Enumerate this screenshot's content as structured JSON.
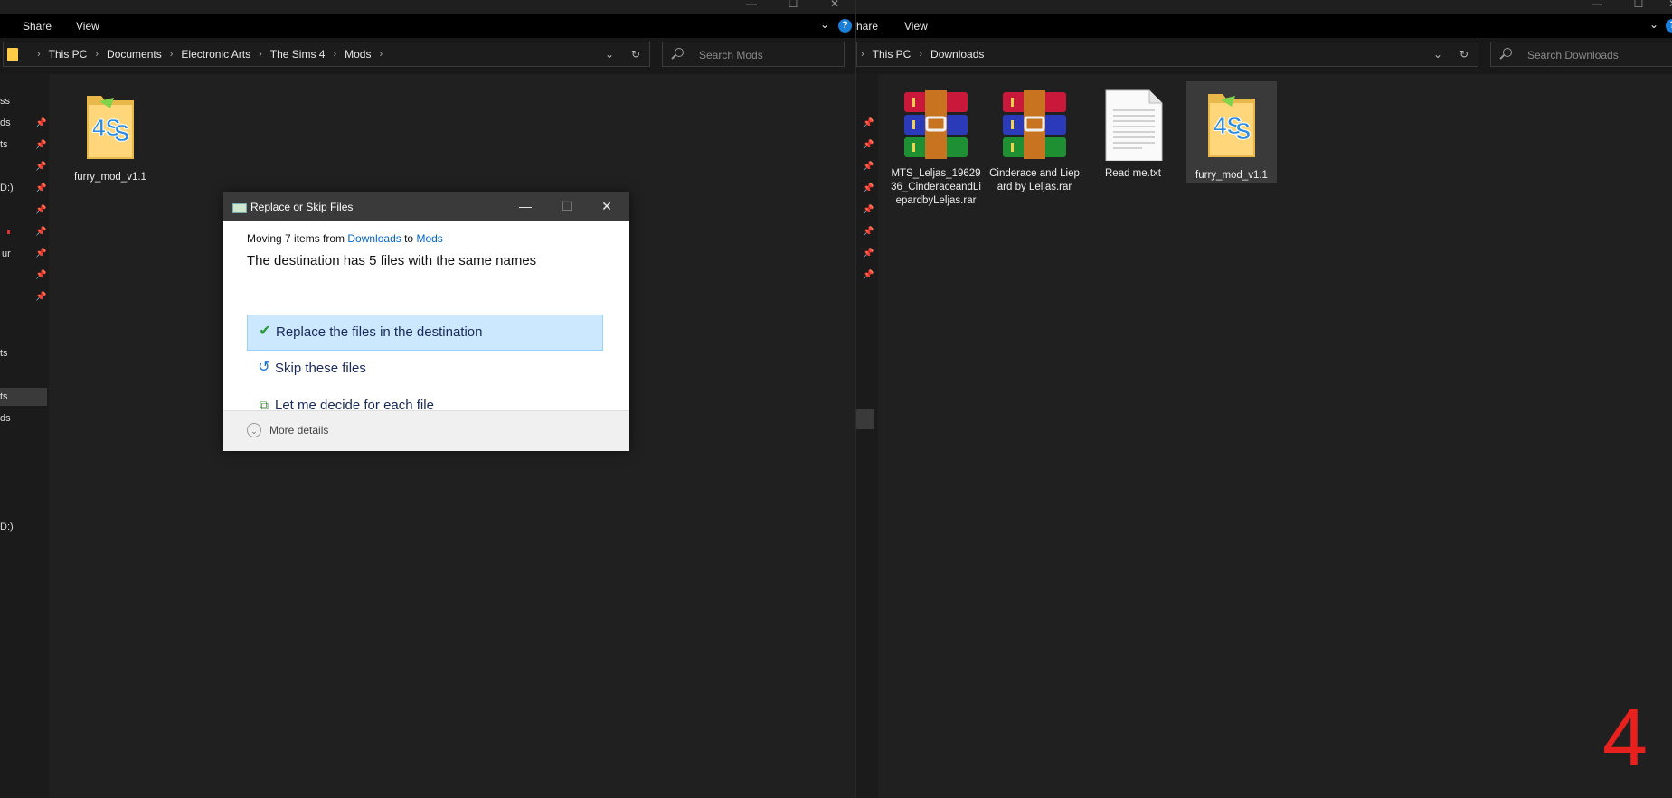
{
  "left_window": {
    "ribbon": {
      "tabs": [
        "Share",
        "View"
      ]
    },
    "address": {
      "crumbs": [
        "This PC",
        "Documents",
        "Electronic Arts",
        "The Sims 4",
        "Mods"
      ]
    },
    "search": {
      "placeholder": "Search Mods"
    },
    "nav_partial": [
      "ss",
      "ds",
      "ts",
      "D:)",
      "ur",
      "ts",
      "ts",
      "ds",
      "D:)"
    ],
    "items": [
      {
        "name": "furry_mod_v1.1"
      }
    ]
  },
  "right_window": {
    "ribbon": {
      "tabs": [
        "hare",
        "View"
      ]
    },
    "address": {
      "crumbs": [
        "This PC",
        "Downloads"
      ]
    },
    "search": {
      "placeholder": "Search Downloads"
    },
    "items": [
      {
        "name": "MTS_Leljas_1962936_CinderaceandLiepardbyLeljas.rar",
        "icon": "winrar-archive-icon"
      },
      {
        "name": "Cinderace and Liepard by Leljas.rar",
        "icon": "winrar-archive-icon"
      },
      {
        "name": "Read me.txt",
        "icon": "text-file-icon"
      },
      {
        "name": "furry_mod_v1.1",
        "icon": "sims-folder-icon"
      }
    ]
  },
  "dialog": {
    "title": "Replace or Skip Files",
    "moving_prefix": "Moving 7 items from",
    "source": "Downloads",
    "to_word": "to",
    "destination": "Mods",
    "headline": "The destination has 5 files with the same names",
    "options": {
      "replace": "Replace the files in the destination",
      "skip": "Skip these files",
      "decide": "Let me decide for each file"
    },
    "more_details": "More details"
  },
  "overlay_number": "4",
  "colors": {
    "accent": "#0078d7",
    "highlight": "#cce8ff",
    "overlay_number": "#e8211f"
  }
}
